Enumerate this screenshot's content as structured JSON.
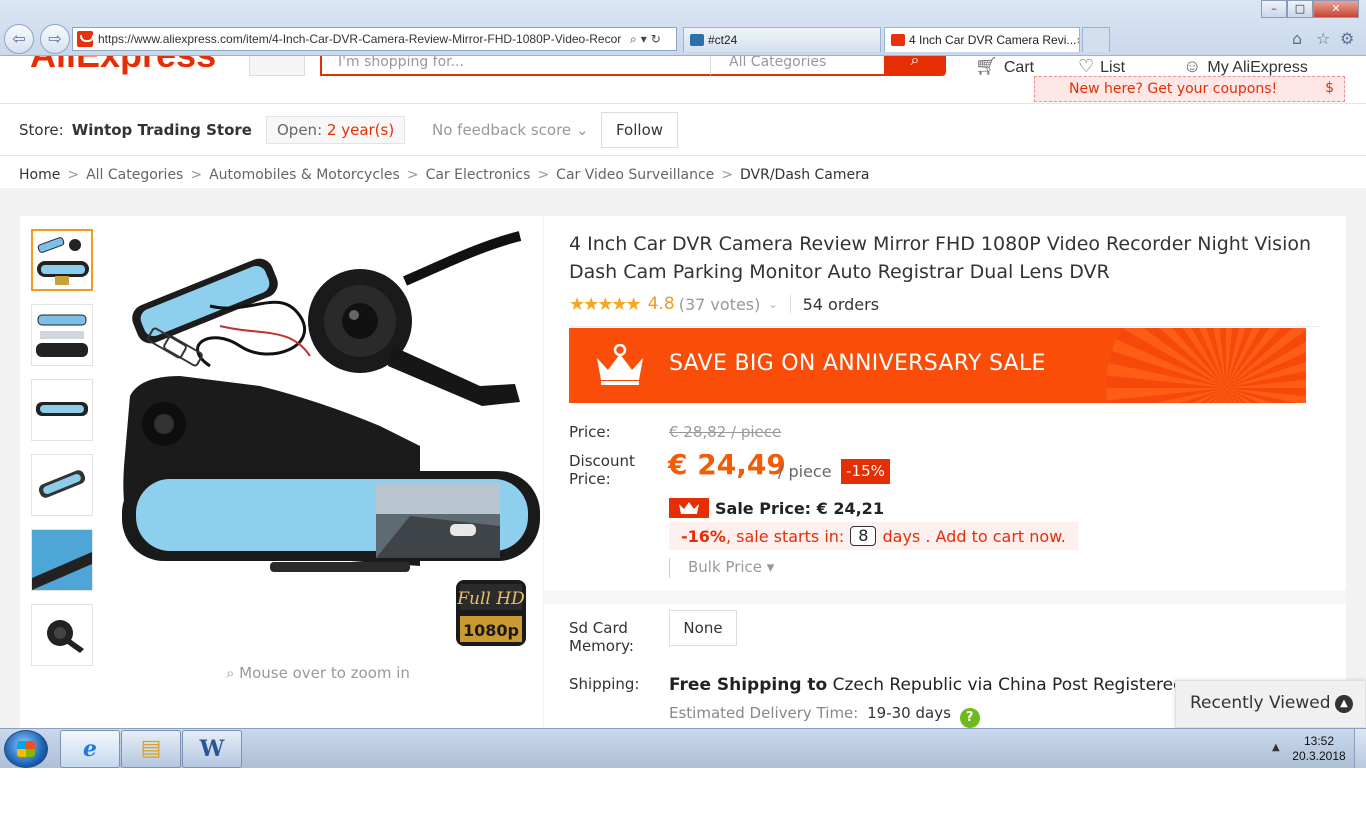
{
  "browser": {
    "url": "https://www.aliexpress.com/item/4-Inch-Car-DVR-Camera-Review-Mirror-FHD-1080P-Video-Recor",
    "tabs": [
      {
        "label": "#ct24"
      },
      {
        "label": "4 Inch Car DVR Camera Revi..."
      }
    ],
    "tab_close": "×",
    "icons": [
      "back-icon",
      "forward-icon",
      "search-icon",
      "refresh-icon",
      "home-icon",
      "star-icon",
      "gear-icon"
    ]
  },
  "header": {
    "logo": "AliExpress",
    "search_placeholder": "I'm shopping for...",
    "category": "All Categories",
    "cart": "Cart",
    "list": "List",
    "account": "My AliExpress",
    "coupon": "New here? Get your coupons!",
    "coupon_symbol": "$"
  },
  "store": {
    "label": "Store:",
    "name": "Wintop Trading Store",
    "open_label": "Open:",
    "open_years": "2 year(s)",
    "feedback": "No feedback score",
    "follow": "Follow"
  },
  "breadcrumb": [
    "Home",
    "All Categories",
    "Automobiles & Motorcycles",
    "Car Electronics",
    "Car Video Surveillance",
    "DVR/Dash Camera"
  ],
  "gallery": {
    "zoom_hint": "Mouse over to zoom in",
    "badge_line1": "Full HD",
    "badge_line2": "1080p",
    "thumb_count": 6,
    "active_thumb": 1
  },
  "product": {
    "title": "4 Inch Car DVR Camera Review Mirror FHD 1080P Video Recorder Night Vision Dash Cam Parking Monitor Auto Registrar Dual Lens DVR",
    "stars": "★★★★★",
    "rating": "4.8",
    "votes": "(37 votes)",
    "orders": "54 orders",
    "sale_banner": "SAVE BIG ON ANNIVERSARY SALE",
    "price_label": "Price:",
    "old_price": "€ 28,82 / piece",
    "discount_label": "Discount Price:",
    "discount_price": "€ 24,49",
    "per_piece": "/ piece",
    "discount_badge": "-15%",
    "sale_price": "Sale Price: € 24,21",
    "sale_pct": "-16%",
    "sale_starts": ", sale starts in:",
    "sale_days": "8",
    "sale_suffix": "days . Add to cart now.",
    "bulk_price": "Bulk Price",
    "sd_label": "Sd Card Memory:",
    "sd_option": "None",
    "shipping_label": "Shipping:",
    "shipping_free": "Free Shipping to",
    "shipping_rest": "Czech Republic via China Post Registered Air Mail",
    "delivery_label": "Estimated Delivery Time:",
    "delivery_days": "19-30 days",
    "help": "?"
  },
  "recently_viewed": "Recently Viewed",
  "taskbar": {
    "time": "13:52",
    "date": "20.3.2018"
  },
  "colors": {
    "brand": "#e62e04",
    "price": "#f25c05",
    "rating": "#f29b1f",
    "banner": "#fa4d09"
  }
}
